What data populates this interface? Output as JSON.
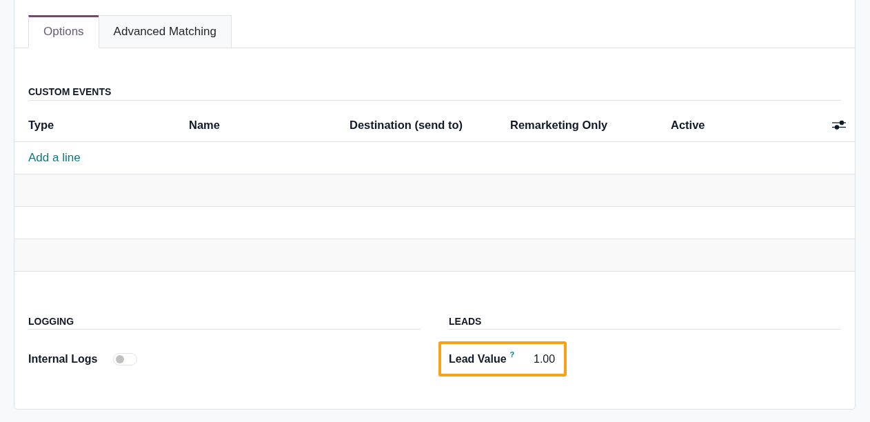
{
  "tabs": [
    {
      "label": "Options",
      "selected": true
    },
    {
      "label": "Advanced Matching",
      "selected": false
    }
  ],
  "custom_events": {
    "title": "CUSTOM EVENTS",
    "columns": [
      "Type",
      "Name",
      "Destination (send to)",
      "Remarketing Only",
      "Active"
    ],
    "add_line": "Add a line"
  },
  "groups": [
    {
      "title": "LOGGING",
      "fields": [
        {
          "kind": "toggle",
          "label": "Internal Logs",
          "on": false
        }
      ]
    },
    {
      "title": "LEADS",
      "fields": [
        {
          "kind": "number",
          "label": "Lead Value",
          "help": "?",
          "value": "1.00",
          "highlighted": true
        }
      ]
    }
  ]
}
